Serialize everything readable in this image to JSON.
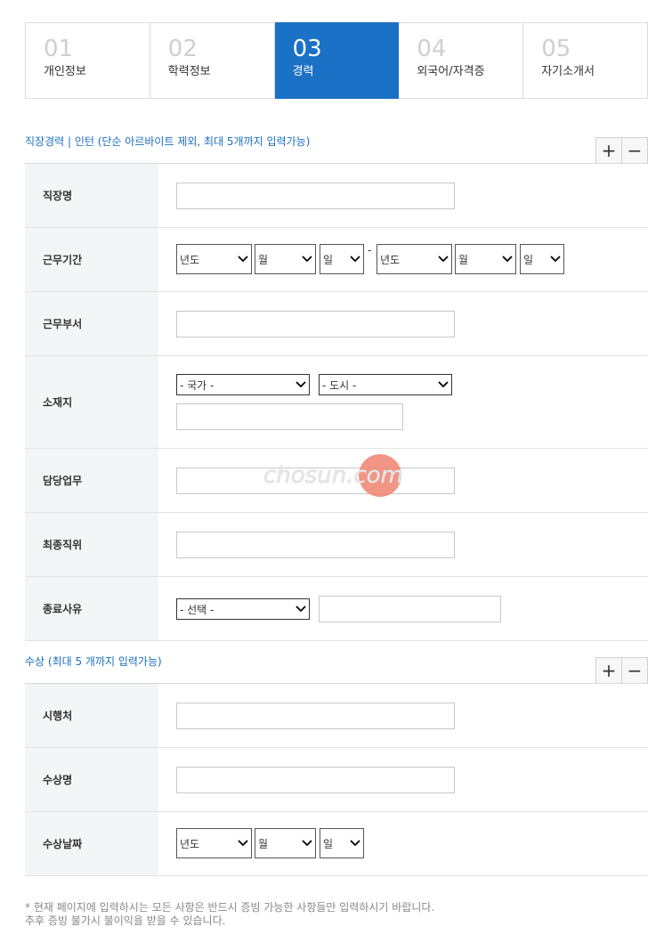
{
  "steps": [
    {
      "num": "01",
      "label": "개인정보",
      "active": false
    },
    {
      "num": "02",
      "label": "학력정보",
      "active": false
    },
    {
      "num": "03",
      "label": "경력",
      "active": true
    },
    {
      "num": "04",
      "label": "외국어/자격증",
      "active": false
    },
    {
      "num": "05",
      "label": "자기소개서",
      "active": false
    }
  ],
  "career": {
    "title": "직장경력 | 인턴 (단순 아르바이트 제외, 최대 5개까지 입력가능)",
    "add": "+",
    "remove": "−",
    "rows": {
      "company": "직장명",
      "period": "근무기간",
      "department": "근무부서",
      "location": "소재지",
      "duty": "담당업무",
      "final_position": "최종직위",
      "leave_reason": "종료사유"
    },
    "period_selects": {
      "start_year": "년도",
      "start_month": "월",
      "start_day": "일",
      "separator": "-",
      "end_year": "년도",
      "end_month": "월",
      "end_day": "일"
    },
    "location_selects": {
      "country": "- 국가 -",
      "city": "- 도시 -"
    },
    "leave_select": "- 선택 -"
  },
  "award": {
    "title": "수상 (최대 5 개까지 입력가능)",
    "add": "+",
    "remove": "−",
    "rows": {
      "issuer": "시행처",
      "name": "수상명",
      "date": "수상날짜"
    },
    "date_selects": {
      "year": "년도",
      "month": "월",
      "day": "일"
    }
  },
  "note": {
    "line1": "* 현재 페이지에 입력하시는 모든 사항은 반드시 증빙 가능한 사항들만 입력하시기 바랍니다.",
    "line2": "추후 증빙 불가시 불이익을 받을 수 있습니다."
  },
  "watermark": "chosun.com",
  "colors": {
    "accent": "#1b71c5",
    "title": "#1b6ec2",
    "watermark_dot": "#f08a78"
  }
}
